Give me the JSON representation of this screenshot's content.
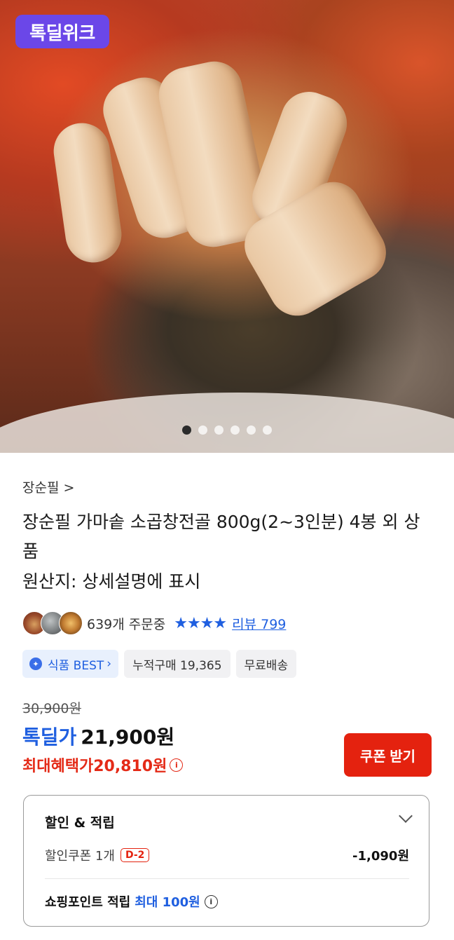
{
  "badge": {
    "label": "톡딜위크"
  },
  "carousel": {
    "total_slides": 6,
    "active_index": 0
  },
  "product": {
    "brand": "장순필 >",
    "title": "장순필 가마솥 소곱창전골 800g(2~3인분) 4봉 외 상품",
    "origin": "원산지: 상세설명에 표시"
  },
  "social": {
    "orders_text": "639개 주문중",
    "rating_stars": 4,
    "review_label": "리뷰 799"
  },
  "chips": {
    "best": "식품 BEST",
    "cumulative": "누적구매 19,365",
    "shipping": "무료배송"
  },
  "price": {
    "original": "30,900원",
    "deal_label": "톡딜가",
    "deal_price": "21,900원",
    "max_benefit": "최대혜택가20,810원"
  },
  "coupon_button": "쿠폰 받기",
  "discount_box": {
    "title": "할인 & 적립",
    "coupon_row_label": "할인쿠폰 1개",
    "coupon_dday": "D-2",
    "coupon_amount": "-1,090원",
    "points_label": "쇼핑포인트 적립",
    "points_value": "최대 100원"
  },
  "colors": {
    "accent_blue": "#1f5fe0",
    "accent_red": "#e42a17",
    "badge_purple": "#6b47e8"
  }
}
